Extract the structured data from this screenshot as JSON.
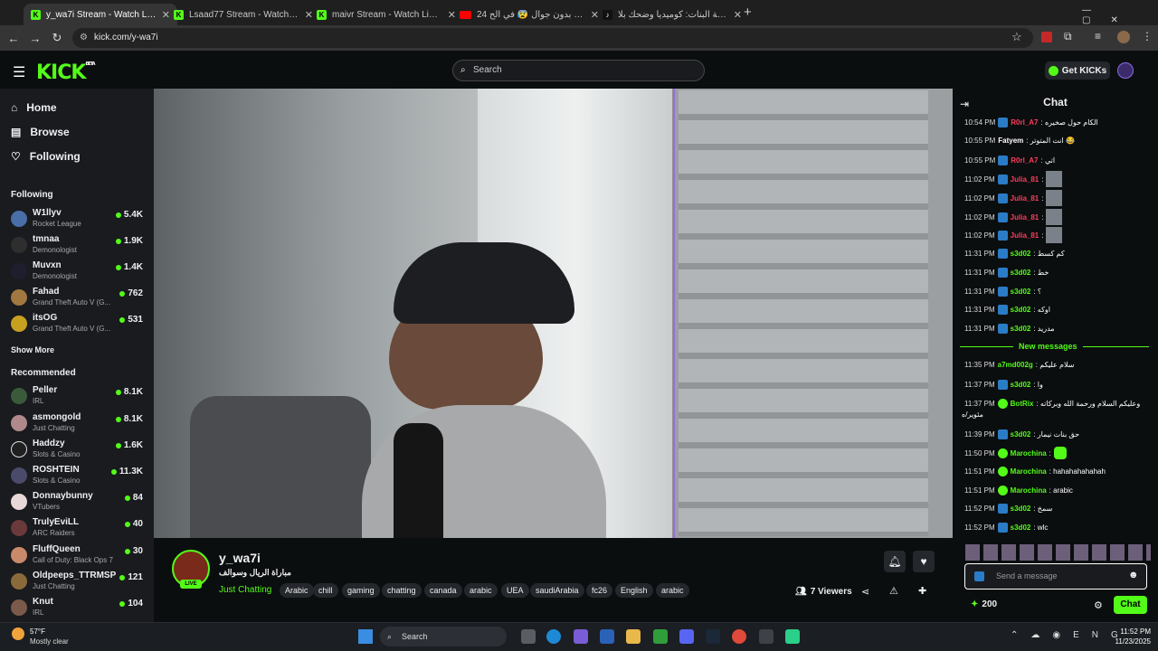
{
  "browser": {
    "tabs": [
      {
        "title": "y_wa7i Stream - Watch Live o",
        "active": true
      },
      {
        "title": "Lsaad77 Stream - Watch Live o"
      },
      {
        "title": "maivr Stream - Watch Live on K"
      },
      {
        "title": "24 ساعة بدون جوال 😰 في الح..."
      },
      {
        "title": "سواقة البنات: كوميديا وضحك بلا..."
      }
    ],
    "url": "kick.com/y-wa7i"
  },
  "header": {
    "logo": "KICK",
    "logo_sup": "BETA",
    "search_placeholder": "Search",
    "get_kicks": "Get KICKs"
  },
  "sidebar": {
    "nav": [
      {
        "label": "Home"
      },
      {
        "label": "Browse"
      },
      {
        "label": "Following"
      }
    ],
    "following_title": "Following",
    "following": [
      {
        "name": "W1llyv",
        "category": "Rocket League",
        "viewers": "5.4K"
      },
      {
        "name": "tmnaa",
        "category": "Demonologist",
        "viewers": "1.9K"
      },
      {
        "name": "Muvxn",
        "category": "Demonologist",
        "viewers": "1.4K"
      },
      {
        "name": "Fahad",
        "category": "Grand Theft Auto V (G...",
        "viewers": "762"
      },
      {
        "name": "itsOG",
        "category": "Grand Theft Auto V (G...",
        "viewers": "531"
      }
    ],
    "show_more": "Show More",
    "recommended_title": "Recommended",
    "recommended": [
      {
        "name": "Peller",
        "category": "IRL",
        "viewers": "8.1K"
      },
      {
        "name": "asmongold",
        "category": "Just Chatting",
        "viewers": "8.1K"
      },
      {
        "name": "Haddzy",
        "category": "Slots & Casino",
        "viewers": "1.6K"
      },
      {
        "name": "ROSHTEIN",
        "category": "Slots & Casino",
        "viewers": "11.3K"
      },
      {
        "name": "Donnaybunny",
        "category": "VTubers",
        "viewers": "84"
      },
      {
        "name": "TrulyEviLL",
        "category": "ARC Raiders",
        "viewers": "40"
      },
      {
        "name": "FluffQueen",
        "category": "Call of Duty: Black Ops 7",
        "viewers": "30"
      },
      {
        "name": "Oldpeeps_TTRMSP",
        "category": "Just Chatting",
        "viewers": "121"
      },
      {
        "name": "Knut",
        "category": "IRL",
        "viewers": "104"
      }
    ]
  },
  "stream": {
    "channel": "y_wa7i",
    "live_badge": "LIVE",
    "title": "مباراة الريال وسوالف",
    "category": "Just Chatting",
    "tags": [
      "Arabic",
      "chill",
      "gaming",
      "chatting",
      "canada",
      "arabic",
      "UEA",
      "saudiArabia",
      "fc26",
      "English",
      "arabic"
    ],
    "viewers": "7 Viewers"
  },
  "chat": {
    "title": "Chat",
    "messages": [
      {
        "time": "10:54 PM",
        "user": "R0rl_A7",
        "color": "#ff3b5c",
        "text": ": الكام حول صخيره"
      },
      {
        "time": "10:55 PM",
        "user": "Fatyem",
        "color": "#ffffff",
        "text": ": انت المتوتر 😂"
      },
      {
        "time": "10:55 PM",
        "user": "R0rl_A7",
        "color": "#ff3b5c",
        "text": ": اتي"
      },
      {
        "time": "11:02 PM",
        "user": "Julia_81",
        "color": "#ff3b5c",
        "text": ":"
      },
      {
        "time": "11:02 PM",
        "user": "Julia_81",
        "color": "#ff3b5c",
        "text": ":"
      },
      {
        "time": "11:02 PM",
        "user": "Julia_81",
        "color": "#ff3b5c",
        "text": ":"
      },
      {
        "time": "11:02 PM",
        "user": "Julia_81",
        "color": "#ff3b5c",
        "text": ":"
      },
      {
        "time": "11:31 PM",
        "user": "s3d02",
        "color": "#53fc18",
        "text": ": كم كسط"
      },
      {
        "time": "11:31 PM",
        "user": "s3d02",
        "color": "#53fc18",
        "text": ": خط"
      },
      {
        "time": "11:31 PM",
        "user": "s3d02",
        "color": "#53fc18",
        "text": ": ؟"
      },
      {
        "time": "11:31 PM",
        "user": "s3d02",
        "color": "#53fc18",
        "text": ": اوكه"
      },
      {
        "time": "11:31 PM",
        "user": "s3d02",
        "color": "#53fc18",
        "text": ": مدريد"
      }
    ],
    "new_messages": "New messages",
    "new": [
      {
        "time": "11:35 PM",
        "user": "a7md002g",
        "color": "#53fc18",
        "text": ": سلام عليكم"
      },
      {
        "time": "11:37 PM",
        "user": "s3d02",
        "color": "#53fc18",
        "text": ": وا"
      },
      {
        "time": "11:37 PM",
        "user": "BotRix",
        "color": "#53fc18",
        "text": ": وعليكم السلام ورحمة الله وبركاته"
      },
      {
        "time": "",
        "user": "",
        "color": "#ffffff",
        "text": "مئوير/ه"
      },
      {
        "time": "11:39 PM",
        "user": "s3d02",
        "color": "#53fc18",
        "text": ": حق بنات نيمار"
      },
      {
        "time": "11:50 PM",
        "user": "Marochina",
        "color": "#53fc18",
        "text": ":"
      },
      {
        "time": "11:51 PM",
        "user": "Marochina",
        "color": "#53fc18",
        "text": ": hahahahahahah"
      },
      {
        "time": "11:51 PM",
        "user": "Marochina",
        "color": "#53fc18",
        "text": ": arabic"
      },
      {
        "time": "11:52 PM",
        "user": "s3d02",
        "color": "#53fc18",
        "text": ": سمخ"
      },
      {
        "time": "11:52 PM",
        "user": "s3d02",
        "color": "#53fc18",
        "text": ": wlc"
      }
    ],
    "input_placeholder": "Send a message",
    "points": "200",
    "send_label": "Chat"
  },
  "taskbar": {
    "weather_temp": "57°F",
    "weather_desc": "Mostly clear",
    "search": "Search",
    "time": "11:52 PM",
    "date": "11/23/2025"
  }
}
